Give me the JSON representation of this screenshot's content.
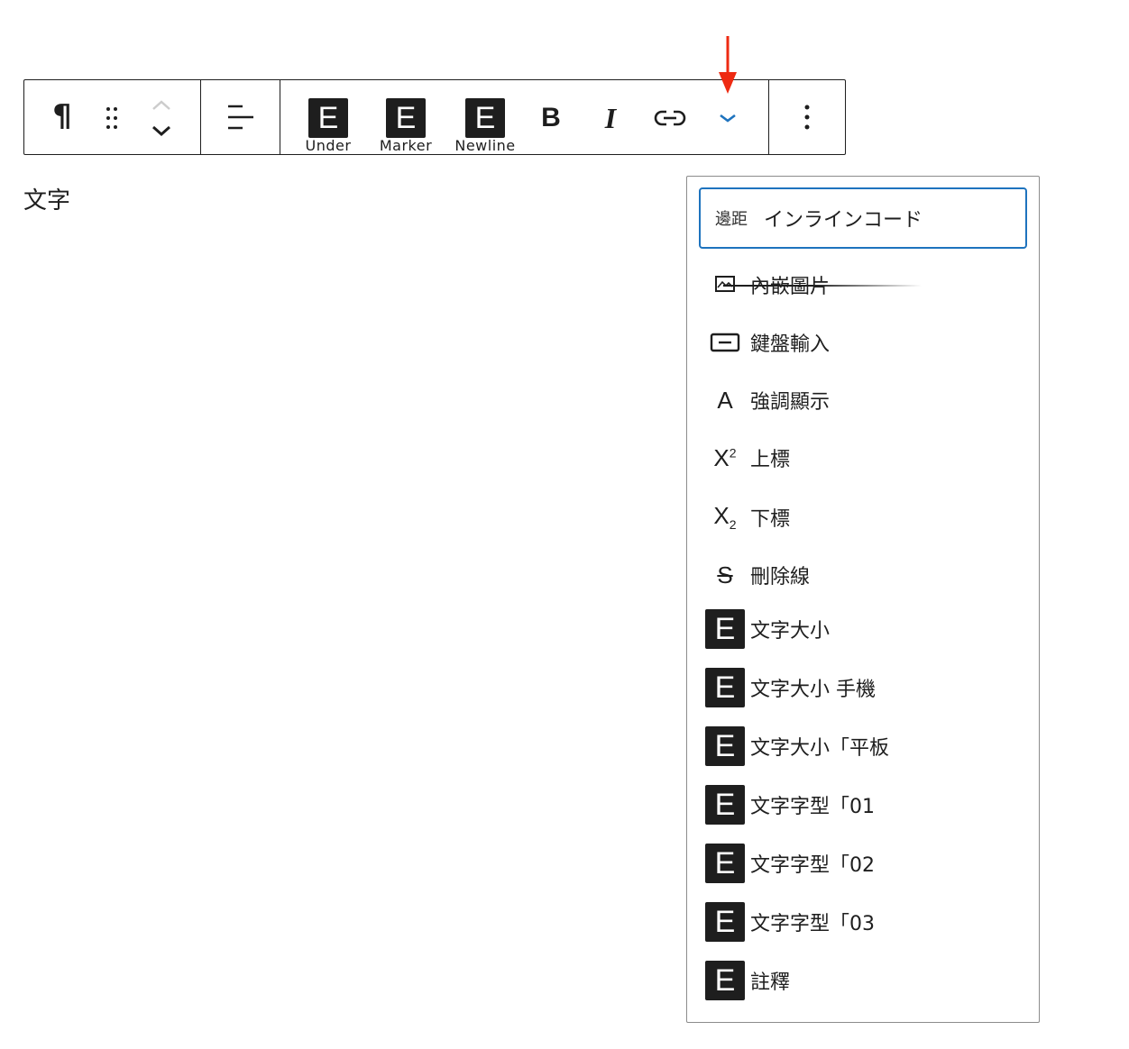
{
  "toolbar": {
    "paragraph_icon": "¶",
    "formats": [
      {
        "icon": "E",
        "label": "Under"
      },
      {
        "icon": "E",
        "label": "Marker"
      },
      {
        "icon": "E",
        "label": "Newline"
      }
    ],
    "bold": "B",
    "italic": "I"
  },
  "content": {
    "text": "文字"
  },
  "dropdown": {
    "focused": {
      "prefix": "邊距",
      "label": "インラインコード"
    },
    "items": [
      {
        "icon": "image-icon",
        "label": "內嵌圖片"
      },
      {
        "icon": "keyboard-icon",
        "label": "鍵盤輸入"
      },
      {
        "icon": "A",
        "label": "強調顯示"
      },
      {
        "icon": "superscript-icon",
        "label": "上標"
      },
      {
        "icon": "subscript-icon",
        "label": "下標"
      },
      {
        "icon": "strikethrough-icon",
        "label": "刪除線"
      },
      {
        "icon": "E",
        "label": "文字大小"
      },
      {
        "icon": "E",
        "label": "文字大小 手機"
      },
      {
        "icon": "E",
        "label": "文字大小「平板"
      },
      {
        "icon": "E",
        "label": "文字字型「01"
      },
      {
        "icon": "E",
        "label": "文字字型「02"
      },
      {
        "icon": "E",
        "label": "文字字型「03"
      },
      {
        "icon": "E",
        "label": "註釋"
      }
    ]
  },
  "colors": {
    "accent": "#1e73be",
    "arrow": "#ee2a12",
    "text": "#1e1e1e"
  }
}
